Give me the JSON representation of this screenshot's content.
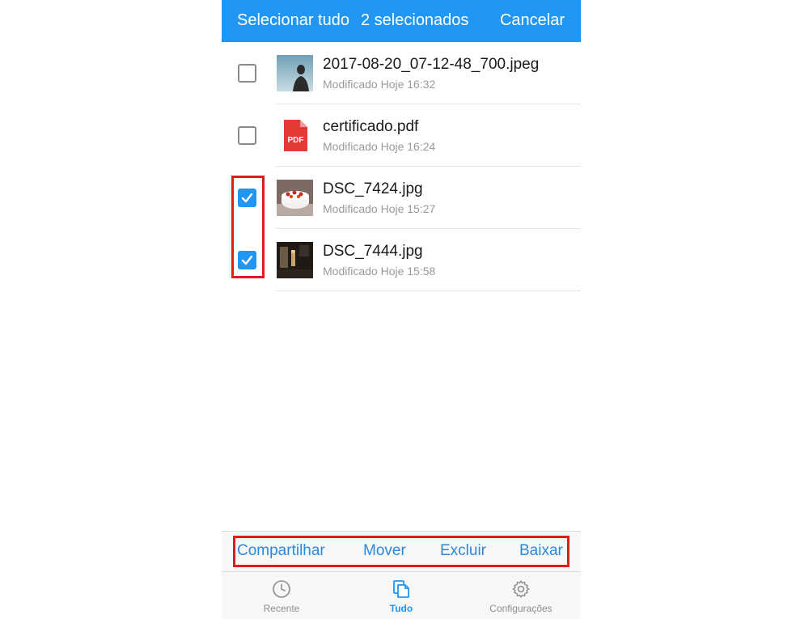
{
  "header": {
    "select_all": "Selecionar tudo",
    "selected_count": "2 selecionados",
    "cancel": "Cancelar",
    "color": "#2196f3"
  },
  "files": [
    {
      "name": "2017-08-20_07-12-48_700.jpeg",
      "meta": "Modificado Hoje 16:32",
      "checked": false,
      "thumb": "person-silhouette-photo"
    },
    {
      "name": "certificado.pdf",
      "meta": "Modificado Hoje 16:24",
      "checked": false,
      "thumb": "pdf-icon"
    },
    {
      "name": "DSC_7424.jpg",
      "meta": "Modificado Hoje 15:27",
      "checked": true,
      "thumb": "cake-photo"
    },
    {
      "name": "DSC_7444.jpg",
      "meta": "Modificado Hoje 15:58",
      "checked": true,
      "thumb": "dark-room-photo"
    }
  ],
  "pdf_icon_label": "PDF",
  "actions": {
    "share": "Compartilhar",
    "move": "Mover",
    "delete": "Excluir",
    "download": "Baixar"
  },
  "tabs": [
    {
      "label": "Recente",
      "icon": "clock-icon",
      "active": false
    },
    {
      "label": "Tudo",
      "icon": "files-icon",
      "active": true
    },
    {
      "label": "Configurações",
      "icon": "gear-icon",
      "active": false
    }
  ],
  "highlight_color": "#e01b1b"
}
